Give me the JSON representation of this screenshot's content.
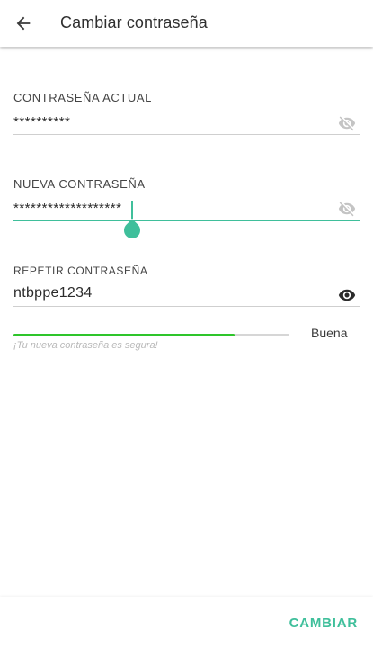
{
  "header": {
    "title": "Cambiar contraseña",
    "back_icon": "arrow-left-icon"
  },
  "fields": {
    "current": {
      "label": "CONTRASEÑA ACTUAL",
      "value": "**********",
      "visibility_icon": "eye-off-icon"
    },
    "new": {
      "label": "NUEVA CONTRASEÑA",
      "value": "*******************",
      "visibility_icon": "eye-off-icon"
    },
    "repeat": {
      "label": "REPETIR CONTRASEÑA",
      "value": "ntbppe1234",
      "visibility_icon": "eye-icon"
    }
  },
  "strength": {
    "label": "Buena",
    "hint": "¡Tu nueva contraseña es segura!",
    "level": 0.8,
    "color": "#2ec52b"
  },
  "actions": {
    "submit_label": "CAMBIAR"
  },
  "colors": {
    "accent": "#3fbf9b",
    "text": "#2b2b2b",
    "divider": "#cfcfcf"
  }
}
